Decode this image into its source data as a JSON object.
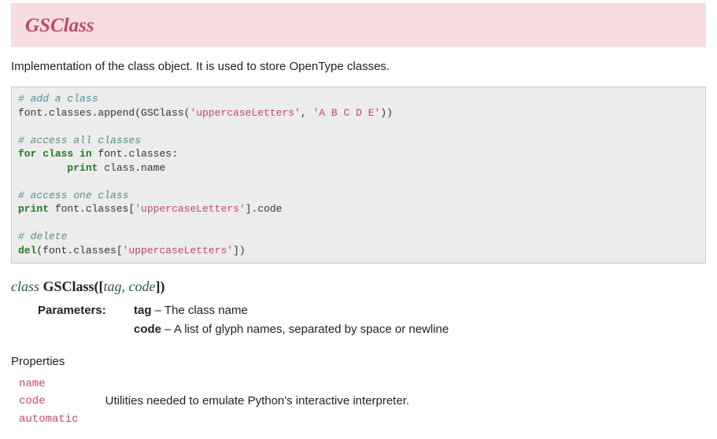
{
  "header": {
    "title": "GSClass"
  },
  "intro": "Implementation of the class object. It is used to store OpenType classes.",
  "code": {
    "c1": "# add a class",
    "l1a": "font.classes.append(GSClass(",
    "l1s1": "'uppercaseLetters'",
    "l1b": ", ",
    "l1s2": "'A B C D E'",
    "l1c": "))",
    "c2": "# access all classes",
    "k_for": "for",
    "k_class": "class",
    "k_in": "in",
    "l2a": " font.classes:",
    "k_print1": "print",
    "l2b": " class.name",
    "c3": "# access one class",
    "k_print2": "print",
    "l3a": " font.classes[",
    "l3s": "'uppercaseLetters'",
    "l3b": "].code",
    "c4": "# delete",
    "k_del": "del",
    "l4a": "(font.classes[",
    "l4s": "'uppercaseLetters'",
    "l4b": "])"
  },
  "signature": {
    "class_kw": "class ",
    "name": "GSClass",
    "open": "([",
    "p1": "tag",
    "comma": ", ",
    "p2": "code",
    "close": "])"
  },
  "params": {
    "label": "Parameters:",
    "list": [
      {
        "name": "tag",
        "sep": " – ",
        "desc": "The class name"
      },
      {
        "name": "code",
        "sep": " – ",
        "desc": "A list of glyph names, separated by space or newline"
      }
    ]
  },
  "properties": {
    "heading": "Properties",
    "names": [
      "name",
      "code",
      "automatic"
    ],
    "desc": "Utilities needed to emulate Python's interactive interpreter."
  }
}
